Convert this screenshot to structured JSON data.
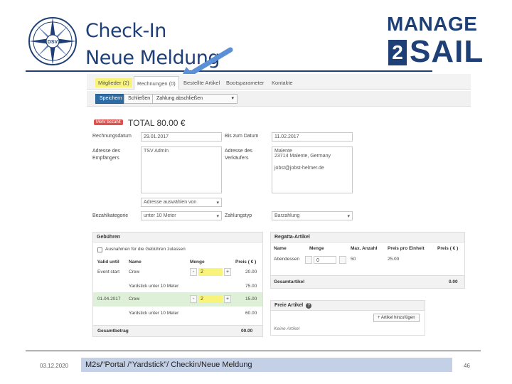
{
  "header": {
    "title_line1": "Check-In",
    "title_line2": "Neue Meldung",
    "logo_left_text": "DSV",
    "logo_right_top": "MANAGE",
    "logo_right_num": "2",
    "logo_right_bottom": "SAIL",
    "brand_color": "#1f3f77",
    "arrow_color": "#5b8fd6"
  },
  "tabs": [
    {
      "label": "Mitglieder (2)",
      "highlighted": true
    },
    {
      "label": "Rechnungen (0)",
      "active": true
    },
    {
      "label": "Bestellte Artikel"
    },
    {
      "label": "Bootsparameter"
    },
    {
      "label": "Kontakte"
    }
  ],
  "toolbar": {
    "save_label": "Speichern",
    "close_label": "Schließen",
    "payment_label": "Zahlung abschließen"
  },
  "invoice": {
    "badge": "Mehr bezahlt",
    "total": "TOTAL 80.00 €",
    "date_label": "Rechnungsdatum",
    "date_value": "29.01.2017",
    "due_label": "Bis zum Datum",
    "due_value": "11.02.2017",
    "recipient_label": "Adresse des Empfängers",
    "recipient_value": "TSV Admin",
    "seller_label": "Adresse des Verkäufers",
    "seller_line1": "Malente",
    "seller_line2": "23714 Malente, Germany",
    "seller_email": "jobst@jobst-helmer.de",
    "address_select": "Adresse auswählen von",
    "category_label": "Bezahlkategorie",
    "category_value": "unter 10 Meter",
    "paytype_label": "Zahlungstyp",
    "paytype_value": "Barzahlung"
  },
  "fees": {
    "title": "Gebühren",
    "exception_label": "Ausnahmen für die Gebühren zulassen",
    "columns": [
      "Valid until",
      "Name",
      "Menge",
      "Preis ( € )"
    ],
    "rows": [
      {
        "valid": "Event start",
        "name": "Crew",
        "qty": "2",
        "price": "20.00",
        "sub": "Yardstick unter 10 Meter",
        "sub_price": "75.00"
      },
      {
        "valid": "01.04.2017",
        "name": "Crew",
        "qty": "2",
        "price": "15.00",
        "sub": "Yardstick unter 10 Meter",
        "sub_price": "60.00"
      }
    ],
    "total_label": "Gesamtbetrag",
    "total_value": "00.00"
  },
  "regatta": {
    "title": "Regatta-Artikel",
    "columns": [
      "Name",
      "Menge",
      "Max. Anzahl",
      "Preis pro Einheit",
      "Preis ( € )"
    ],
    "row": {
      "name": "Abendessen",
      "qty": "0",
      "max": "50",
      "unit": "25.00",
      "price": ""
    },
    "total_label": "Gesamtartikel",
    "total_value": "0.00"
  },
  "free_items": {
    "title": "Freie Artikel",
    "add_label": "+ Artikel hinzufügen",
    "empty_label": "Keine Artikel"
  },
  "footer": {
    "date": "03.12.2020",
    "caption": "M2s/“Portal /“Yardstick”/ Checkin/Neue Meldung",
    "page": "46"
  }
}
